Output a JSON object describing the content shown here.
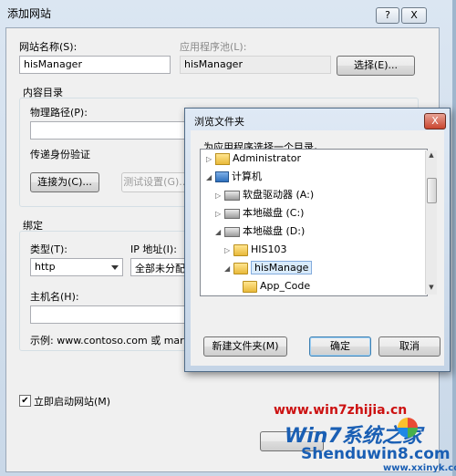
{
  "main_dialog": {
    "title": "添加网站",
    "help_button": "?",
    "close_button": "X",
    "site_name_label": "网站名称(S):",
    "site_name_value": "hisManager",
    "app_pool_label": "应用程序池(L):",
    "app_pool_value": "hisManager",
    "select_button": "选择(E)...",
    "content_dir_label": "内容目录",
    "physical_path_label": "物理路径(P):",
    "passthrough_auth_label": "传递身份验证",
    "connect_as_button": "连接为(C)...",
    "test_settings_button": "测试设置(G)...",
    "binding_label": "绑定",
    "type_label": "类型(T):",
    "type_value": "http",
    "ip_label": "IP 地址(I):",
    "ip_value": "全部未分配",
    "hostname_label": "主机名(H):",
    "example_text": "示例: www.contoso.com 或 mark",
    "start_immediately_label": "立即启动网站(M)"
  },
  "browse_dialog": {
    "title": "浏览文件夹",
    "close_button": "X",
    "prompt": "为应用程序选择一个目录。",
    "tree": [
      {
        "label": "Administrator",
        "icon": "user-folder-icon",
        "toggle": "▷"
      },
      {
        "label": "计算机",
        "icon": "computer-icon",
        "toggle": "◢"
      },
      {
        "label": "软盘驱动器 (A:)",
        "icon": "floppy-drive-icon",
        "toggle": "▷"
      },
      {
        "label": "本地磁盘 (C:)",
        "icon": "disk-drive-icon",
        "toggle": "▷"
      },
      {
        "label": "本地磁盘 (D:)",
        "icon": "disk-drive-icon",
        "toggle": "◢"
      },
      {
        "label": "HIS103",
        "icon": "folder-icon",
        "toggle": "▷"
      },
      {
        "label": "hisManage",
        "icon": "folder-icon",
        "toggle": "◢"
      },
      {
        "label": "App_Code",
        "icon": "folder-icon",
        "toggle": ""
      }
    ],
    "new_folder_button": "新建文件夹(M)",
    "ok_button": "确定",
    "cancel_button": "取消"
  },
  "watermarks": {
    "url_top": "www.win7zhijia.cn",
    "logo_text": "Win7系统之家",
    "brand": "Shenduwin8.com",
    "url_bottom": "www.xxinyk.com"
  },
  "colors": {
    "watermark_red": "#cc1111",
    "watermark_blue": "#1a5fb4",
    "selection": "#d9ebfb"
  }
}
